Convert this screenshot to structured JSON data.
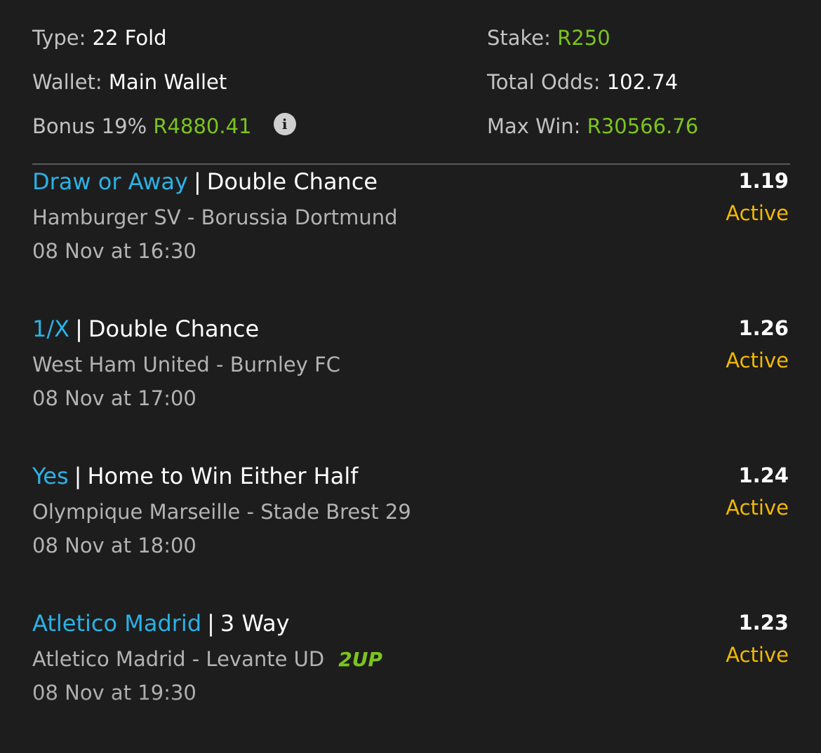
{
  "summary": {
    "type_label": "Type:",
    "type_value": "22 Fold",
    "wallet_label": "Wallet:",
    "wallet_value": "Main Wallet",
    "bonus_label": "Bonus 19%",
    "bonus_value": "R4880.41",
    "info_icon": "i",
    "stake_label": "Stake:",
    "stake_value": "R250",
    "total_odds_label": "Total Odds:",
    "total_odds_value": "102.74",
    "max_win_label": "Max Win:",
    "max_win_value": "R30566.76"
  },
  "bets": [
    {
      "selection": "Draw or Away",
      "separator": "|",
      "market": "Double Chance",
      "match": "Hamburger SV - Borussia Dortmund",
      "datetime": "08 Nov at 16:30",
      "odds": "1.19",
      "status": "Active"
    },
    {
      "selection": "1/X",
      "separator": "|",
      "market": "Double Chance",
      "match": "West Ham United - Burnley FC",
      "datetime": "08 Nov at 17:00",
      "odds": "1.26",
      "status": "Active"
    },
    {
      "selection": "Yes",
      "separator": "|",
      "market": "Home to Win Either Half",
      "match": "Olympique Marseille - Stade Brest 29",
      "datetime": "08 Nov at 18:00",
      "odds": "1.24",
      "status": "Active"
    },
    {
      "selection": "Atletico Madrid",
      "separator": "|",
      "market": "3 Way",
      "match": "Atletico Madrid - Levante UD",
      "badge": "2UP",
      "datetime": "08 Nov at 19:30",
      "odds": "1.23",
      "status": "Active"
    }
  ],
  "colors": {
    "background": "#1d1d1d",
    "selection_blue": "#2ab2e6",
    "money_green": "#7bc41e",
    "status_yellow": "#f2b805",
    "label_grey": "#c2c2c2"
  }
}
